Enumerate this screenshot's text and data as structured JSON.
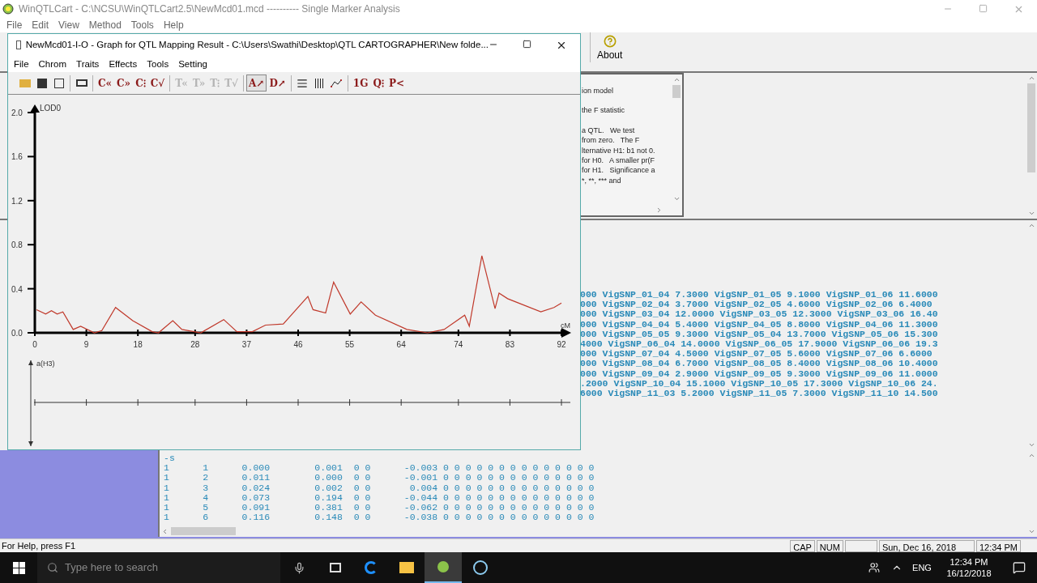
{
  "main_window": {
    "title": "WinQTLCart - C:\\NCSU\\WinQTLCart2.5\\NewMcd01.mcd ---------- Single Marker Analysis",
    "menu": [
      "File",
      "Edit",
      "View",
      "Method",
      "Tools",
      "Help"
    ],
    "toolbar": {
      "about": "About"
    }
  },
  "help_panel": {
    "paragraphs": [
      [
        "ion model"
      ],
      [
        "the F statistic"
      ],
      [
        "a QTL.   We test",
        "from zero.   The F",
        "lternative H1: b1 not 0.",
        "for H0.   A smaller pr(F",
        "for H1.   Significance a",
        "*, **, *** and"
      ]
    ]
  },
  "output_lines": [
    "000 VigSNP_01_04 7.3000 VigSNP_01_05 9.1000 VigSNP_01_06 11.6000",
    "000 VigSNP_02_04 3.7000 VigSNP_02_05 4.6000 VigSNP_02_06 6.4000",
    "000 VigSNP_03_04 12.0000 VigSNP_03_05 12.3000 VigSNP_03_06 16.40",
    "000 VigSNP_04_04 5.4000 VigSNP_04_05 8.8000 VigSNP_04_06 11.3000",
    "000 VigSNP_05_05 9.3000 VigSNP_05_04 13.7000 VigSNP_05_06 15.300",
    "4000 VigSNP_06_04 14.0000 VigSNP_06_05 17.9000 VigSNP_06_06 19.3",
    "000 VigSNP_07_04 4.5000 VigSNP_07_05 5.6000 VigSNP_07_06 6.6000",
    "000 VigSNP_08_04 6.7000 VigSNP_08_05 8.4000 VigSNP_08_06 10.4000",
    "000 VigSNP_09_04 2.9000 VigSNP_09_05 9.3000 VigSNP_09_06 11.0000",
    ".2000 VigSNP_10_04 15.1000 VigSNP_10_05 17.3000 VigSNP_10_06 24.",
    "6000 VigSNP_11_03 5.2000 VigSNP_11_05 7.3000 VigSNP_11_10 14.500"
  ],
  "result_table": {
    "header": "-s",
    "rows": [
      "1      1      0.000        0.001  0 0      -0.003 0 0 0 0 0 0 0 0 0 0 0 0 0 0",
      "1      2      0.011        0.000  0 0      -0.001 0 0 0 0 0 0 0 0 0 0 0 0 0 0",
      "1      3      0.024        0.002  0 0       0.004 0 0 0 0 0 0 0 0 0 0 0 0 0 0",
      "1      4      0.073        0.194  0 0      -0.044 0 0 0 0 0 0 0 0 0 0 0 0 0 0",
      "1      5      0.091        0.381  0 0      -0.062 0 0 0 0 0 0 0 0 0 0 0 0 0 0",
      "1      6      0.116        0.148  0 0      -0.038 0 0 0 0 0 0 0 0 0 0 0 0 0 0"
    ]
  },
  "graph_window": {
    "title": "NewMcd01-I-O - Graph for QTL Mapping Result - C:\\Users\\Swathi\\Desktop\\QTL CARTOGRAPHER\\New folde...",
    "menu": [
      "File",
      "Chrom",
      "Traits",
      "Effects",
      "Tools",
      "Setting"
    ],
    "toolbar_groups": [
      [
        {
          "label": "C«",
          "disabled": false,
          "pressed": false
        },
        {
          "label": "C»",
          "disabled": false,
          "pressed": false
        },
        {
          "label": "C⁝",
          "disabled": false,
          "pressed": false
        },
        {
          "label": "C√",
          "disabled": false,
          "pressed": false
        }
      ],
      [
        {
          "label": "T«",
          "disabled": true,
          "pressed": false
        },
        {
          "label": "T»",
          "disabled": true,
          "pressed": false
        },
        {
          "label": "T⁝",
          "disabled": true,
          "pressed": false
        },
        {
          "label": "T√",
          "disabled": true,
          "pressed": false
        }
      ],
      [
        {
          "label": "A↗",
          "disabled": false,
          "pressed": true
        },
        {
          "label": "D↗",
          "disabled": false,
          "pressed": false
        }
      ],
      [
        {
          "label": "1G",
          "disabled": false,
          "pressed": false
        },
        {
          "label": "Q⁝",
          "disabled": false,
          "pressed": false
        },
        {
          "label": "P<",
          "disabled": false,
          "pressed": false
        }
      ]
    ],
    "chart_data": {
      "type": "line",
      "xlabel": "cM",
      "xlim": [
        0,
        92
      ],
      "ylim": [
        0,
        2
      ],
      "xticks": [
        0,
        9,
        18,
        28,
        37,
        46,
        55,
        64,
        74,
        83,
        92
      ],
      "yticks": [
        {
          "value": 0,
          "label": "0.0"
        },
        {
          "value": 0.4,
          "label": "0.4"
        },
        {
          "value": 0.8,
          "label": "0.8"
        },
        {
          "value": 1.2,
          "label": "1.2"
        },
        {
          "value": 1.6,
          "label": "1.6"
        },
        {
          "value": 2,
          "label": "2.0"
        }
      ],
      "x": [
        0.3,
        1.9,
        2.9,
        3.9,
        4.9,
        6.7,
        8,
        10.4,
        11.7,
        14.1,
        17.1,
        20.5,
        21.6,
        24.1,
        25.7,
        29,
        33,
        35.3,
        38,
        40.3,
        43.4,
        47.7,
        48.6,
        50.8,
        52.2,
        55.1,
        57,
        59.5,
        65,
        68.6,
        71.5,
        75.1,
        75.9,
        78.1,
        80.4,
        81.1,
        82.6,
        88.4,
        90.7,
        92
      ],
      "series": [
        {
          "name": "LOD0",
          "color": "#c0392b",
          "values": [
            0.21,
            0.17,
            0.2,
            0.17,
            0.19,
            0.03,
            0.06,
            0,
            0.02,
            0.23,
            0.11,
            0.01,
            0,
            0.11,
            0.03,
            0,
            0.12,
            0.01,
            0.01,
            0.07,
            0.08,
            0.33,
            0.21,
            0.18,
            0.46,
            0.17,
            0.28,
            0.16,
            0.03,
            0,
            0.03,
            0.16,
            0.06,
            0.7,
            0.22,
            0.36,
            0.31,
            0.19,
            0.23,
            0.27
          ]
        }
      ]
    },
    "effect_plot": {
      "ylabel": "a(H3)"
    }
  },
  "status_bar": {
    "help": "For Help, press F1",
    "indicators": [
      "CAP",
      "NUM"
    ],
    "date": "Sun, Dec 16, 2018",
    "time": "12:34 PM"
  },
  "taskbar": {
    "search_placeholder": "Type here to search",
    "language": "ENG",
    "time": "12:34 PM",
    "date": "16/12/2018"
  }
}
